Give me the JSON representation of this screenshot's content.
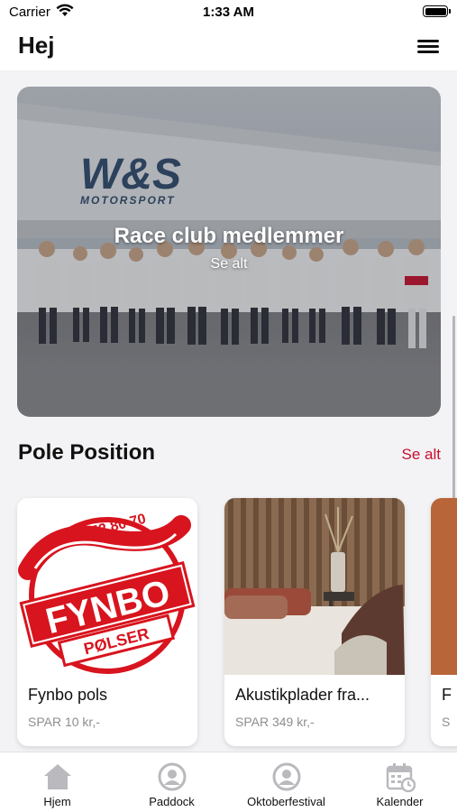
{
  "status_bar": {
    "carrier": "Carrier",
    "time": "1:33 AM"
  },
  "header": {
    "title": "Hej"
  },
  "hero": {
    "title": "Race club medlemmer",
    "link": "Se alt"
  },
  "section": {
    "title": "Pole Position",
    "link": "Se alt"
  },
  "products": [
    {
      "name": "Fynbo pols",
      "price": "SPAR 10 kr,-"
    },
    {
      "name": "Akustikplader fra...",
      "price": "SPAR 349 kr,-"
    },
    {
      "name": "F",
      "price": "S"
    }
  ],
  "fynbo_logo": {
    "phone": "Tlf. 52 52 80 70",
    "brand": "FYNBO",
    "sub": "PØLSER"
  },
  "tent_logo": {
    "brand": "W&S",
    "sub": "MOTORSPORT"
  },
  "tabs": [
    {
      "label": "Hjem",
      "icon": "home-icon"
    },
    {
      "label": "Paddock",
      "icon": "user-circle-icon"
    },
    {
      "label": "Oktoberfestival",
      "icon": "user-circle-icon"
    },
    {
      "label": "Kalender",
      "icon": "calendar-icon"
    }
  ],
  "colors": {
    "accent": "#c8102e",
    "tab_icon": "#b9b9be",
    "background": "#f3f3f5"
  }
}
